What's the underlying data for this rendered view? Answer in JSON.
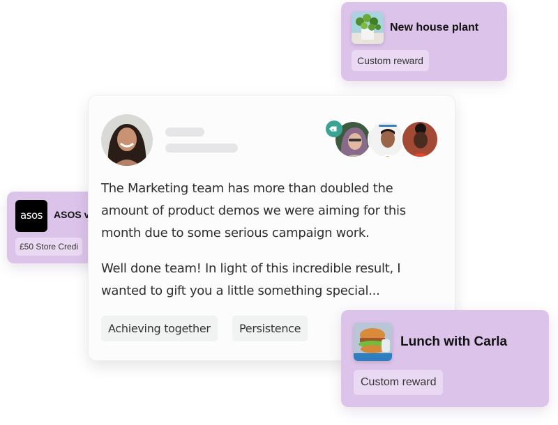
{
  "rewards": {
    "plant": {
      "title": "New house plant",
      "tag": "Custom reward"
    },
    "asos": {
      "logo": "asos",
      "title": "ASOS v",
      "tag": "£50 Store Credi"
    },
    "lunch": {
      "title": "Lunch with Carla",
      "tag": "Custom reward"
    }
  },
  "post": {
    "paragraphs": [
      "The Marketing team has more than doubled the amount of product demos we were aiming for this month due to some serious campaign work.",
      "Well done team! In light of this incredible result, I wanted to gift you a little something special..."
    ],
    "values": [
      "Achieving together",
      "Persistence"
    ],
    "recipient_count": 3
  },
  "colors": {
    "reward_card_bg": "#dcc3ea",
    "reward_tag_bg": "#ead9f2",
    "tag_badge": "#3aa394",
    "skeleton": "#e6e6e8"
  }
}
